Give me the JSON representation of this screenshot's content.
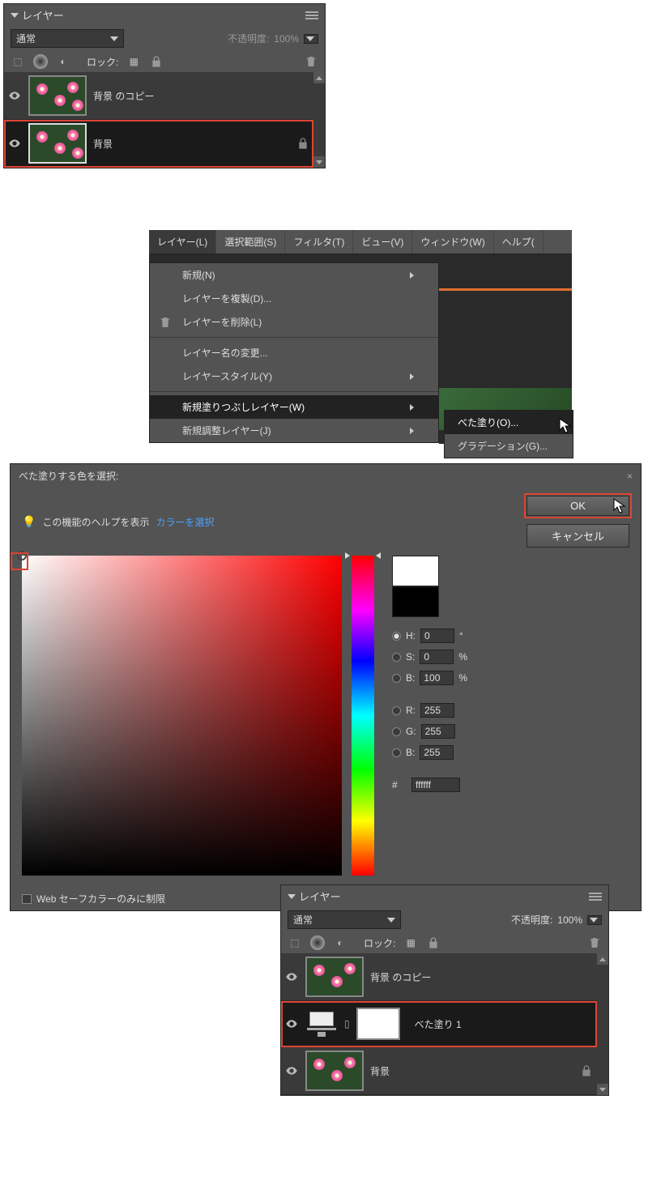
{
  "panel1": {
    "title": "レイヤー",
    "blend_mode": "通常",
    "opacity_label": "不透明度:",
    "opacity_value": "100%",
    "lock_label": "ロック:",
    "layers": [
      {
        "name": "背景 のコピー"
      },
      {
        "name": "背景"
      }
    ]
  },
  "menubar": {
    "items": [
      "レイヤー(L)",
      "選択範囲(S)",
      "フィルタ(T)",
      "ビュー(V)",
      "ウィンドウ(W)",
      "ヘルプ("
    ]
  },
  "menu": {
    "items": [
      {
        "label": "新規(N)",
        "arrow": true
      },
      {
        "label": "レイヤーを複製(D)..."
      },
      {
        "label": "レイヤーを削除(L)"
      }
    ],
    "items2": [
      {
        "label": "レイヤー名の変更..."
      },
      {
        "label": "レイヤースタイル(Y)",
        "arrow": true
      }
    ],
    "items3": [
      {
        "label": "新規塗りつぶしレイヤー(W)",
        "arrow": true,
        "highlight": true
      },
      {
        "label": "新規調整レイヤー(J)",
        "arrow": true
      }
    ]
  },
  "submenu": {
    "items": [
      {
        "label": "べた塗り(O)...",
        "highlight": true
      },
      {
        "label": "グラデーション(G)..."
      }
    ]
  },
  "dialog": {
    "title": "べた塗りする色を選択:",
    "help_text": "この機能のヘルプを表示",
    "help_link": "カラーを選択",
    "ok": "OK",
    "cancel": "キャンセル",
    "H_label": "H:",
    "H_val": "0",
    "H_unit": "°",
    "S_label": "S:",
    "S_val": "0",
    "S_unit": "%",
    "Br_label": "B:",
    "Br_val": "100",
    "Br_unit": "%",
    "R_label": "R:",
    "R_val": "255",
    "G_label": "G:",
    "G_val": "255",
    "B_label": "B:",
    "B_val": "255",
    "hex_label": "#",
    "hex_val": "ffffff",
    "websafe": "Web セーフカラーのみに制限"
  },
  "panel2": {
    "title": "レイヤー",
    "blend_mode": "通常",
    "opacity_label": "不透明度:",
    "opacity_value": "100%",
    "lock_label": "ロック:",
    "layers": [
      {
        "name": "背景 のコピー"
      },
      {
        "name": "べた塗り 1"
      },
      {
        "name": "背景"
      }
    ]
  }
}
